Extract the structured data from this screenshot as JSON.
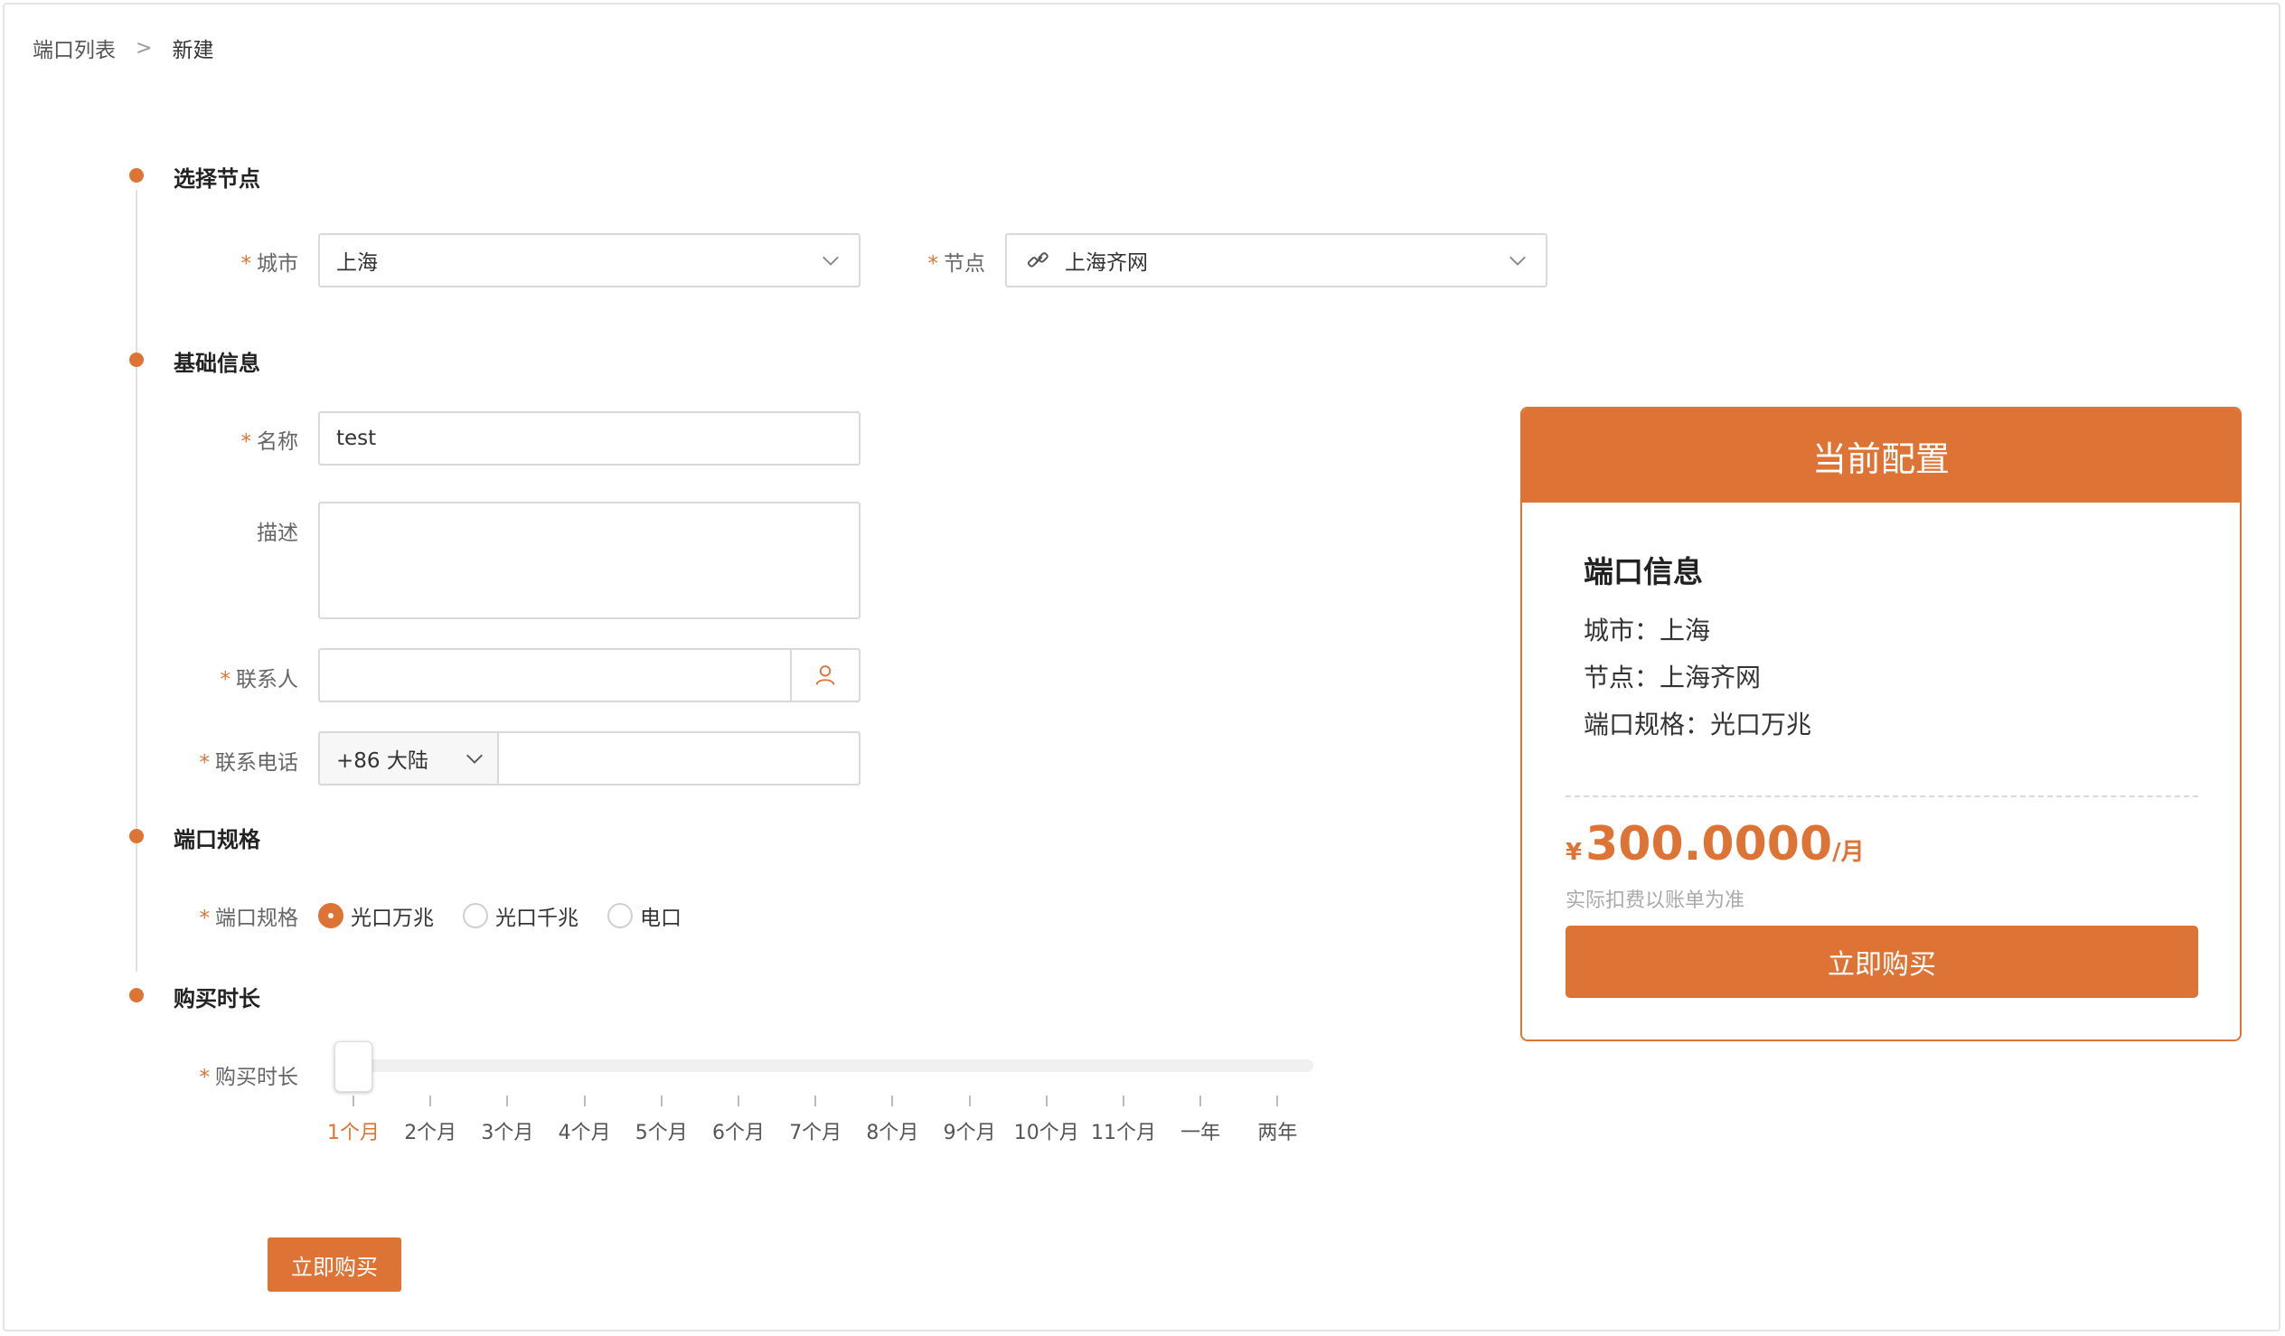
{
  "breadcrumb": {
    "parent": "端口列表",
    "separator": ">",
    "current": "新建"
  },
  "sections": {
    "node": "选择节点",
    "basic": "基础信息",
    "spec": "端口规格",
    "duration": "购买时长"
  },
  "form": {
    "city": {
      "label": "城市",
      "required": "*",
      "value": "上海",
      "icon": "chevron-down-icon"
    },
    "node": {
      "label": "节点",
      "required": "*",
      "value": "上海齐网",
      "icon": "link-icon"
    },
    "name": {
      "label": "名称",
      "required": "*",
      "value": "test"
    },
    "description": {
      "label": "描述",
      "value": ""
    },
    "contact": {
      "label": "联系人",
      "required": "*",
      "value": "",
      "icon": "user-icon"
    },
    "phone": {
      "label": "联系电话",
      "required": "*",
      "country_code": "+86 大陆",
      "value": ""
    },
    "port_spec": {
      "label": "端口规格",
      "required": "*",
      "options": [
        "光口万兆",
        "光口千兆",
        "电口"
      ],
      "selected_index": 0
    },
    "duration": {
      "label": "购买时长",
      "required": "*",
      "ticks": [
        "1个月",
        "2个月",
        "3个月",
        "4个月",
        "5个月",
        "6个月",
        "7个月",
        "8个月",
        "9个月",
        "10个月",
        "11个月",
        "一年",
        "两年"
      ],
      "selected_index": 0
    }
  },
  "submit_label": "立即购买",
  "summary": {
    "header": "当前配置",
    "info_title": "端口信息",
    "city_line": "城市：上海",
    "node_line": "节点：上海齐网",
    "spec_line": "端口规格：光口万兆",
    "currency": "¥",
    "price": "300.0000",
    "unit": "/月",
    "note": "实际扣费以账单为准",
    "buy_label": "立即购买"
  },
  "colors": {
    "accent": "#dd7436",
    "border": "#d9d9d9",
    "track": "#f0f0f0"
  }
}
